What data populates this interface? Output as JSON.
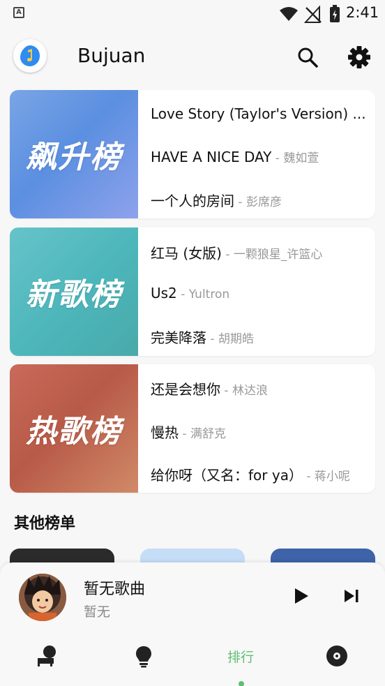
{
  "status_bar": {
    "time": "2:41",
    "app_indicator": "A",
    "icons": [
      "wifi-icon",
      "no-signal-icon",
      "battery-charging-icon"
    ]
  },
  "app_bar": {
    "title": "Bujuan",
    "logo_icon": "music-note-icon",
    "actions": [
      "search-icon",
      "settings-icon"
    ]
  },
  "charts": [
    {
      "cover_label": "飙升榜",
      "tracks": [
        {
          "title": "Love Story (Taylor's Version) ...",
          "artist": ""
        },
        {
          "title": "HAVE A NICE DAY",
          "artist": " - 魏如萱"
        },
        {
          "title": "一个人的房间",
          "artist": " - 彭席彦"
        }
      ]
    },
    {
      "cover_label": "新歌榜",
      "tracks": [
        {
          "title": "红马 (女版)",
          "artist": " - 一颗狼星_许篮心"
        },
        {
          "title": "Us2",
          "artist": " - Yultron"
        },
        {
          "title": "完美降落",
          "artist": " - 胡期皓"
        }
      ]
    },
    {
      "cover_label": "热歌榜",
      "tracks": [
        {
          "title": "还是会想你",
          "artist": " - 林达浪"
        },
        {
          "title": "慢热",
          "artist": " - 满舒克"
        },
        {
          "title": "给你呀（又名：for ya）",
          "artist": " - 蒋小呢"
        }
      ]
    }
  ],
  "other_section": {
    "title": "其他榜单"
  },
  "player": {
    "song_title": "暂无歌曲",
    "artist": "暂无",
    "controls": [
      "play-icon",
      "skip-next-icon"
    ]
  },
  "bottom_nav": {
    "items": [
      {
        "name": "personal",
        "icon": "person-icon",
        "label": ""
      },
      {
        "name": "discover",
        "icon": "lightbulb-icon",
        "label": ""
      },
      {
        "name": "ranking",
        "icon": "",
        "label": "排行"
      },
      {
        "name": "album",
        "icon": "disc-icon",
        "label": ""
      }
    ],
    "active_index": 2
  },
  "colors": {
    "accent": "#5cbf70",
    "soaring_cover": "#6f98e3",
    "new_cover": "#4fb7bb",
    "hot_cover": "#c06a55"
  }
}
